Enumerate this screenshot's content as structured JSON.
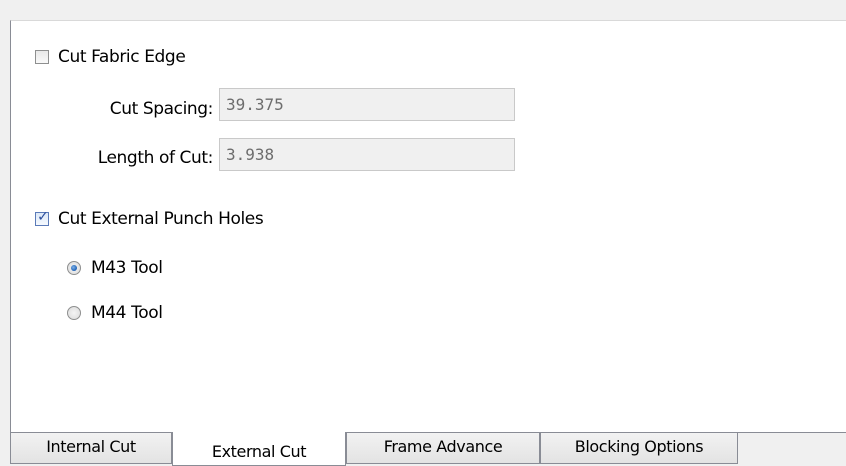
{
  "options": {
    "cut_fabric_edge": {
      "label": "Cut Fabric Edge",
      "checked": false
    },
    "cut_spacing": {
      "label": "Cut Spacing:",
      "value": "39.375"
    },
    "length_of_cut": {
      "label": "Length of Cut:",
      "value": "3.938"
    },
    "cut_external_punch_holes": {
      "label": "Cut External Punch Holes",
      "checked": true
    },
    "tool_options": [
      {
        "label": "M43 Tool",
        "selected": true
      },
      {
        "label": "M44 Tool",
        "selected": false
      }
    ]
  },
  "tabs": [
    {
      "label": "Internal Cut",
      "active": false
    },
    {
      "label": "External Cut",
      "active": true
    },
    {
      "label": "Frame Advance",
      "active": false
    },
    {
      "label": "Blocking Options",
      "active": false
    }
  ]
}
